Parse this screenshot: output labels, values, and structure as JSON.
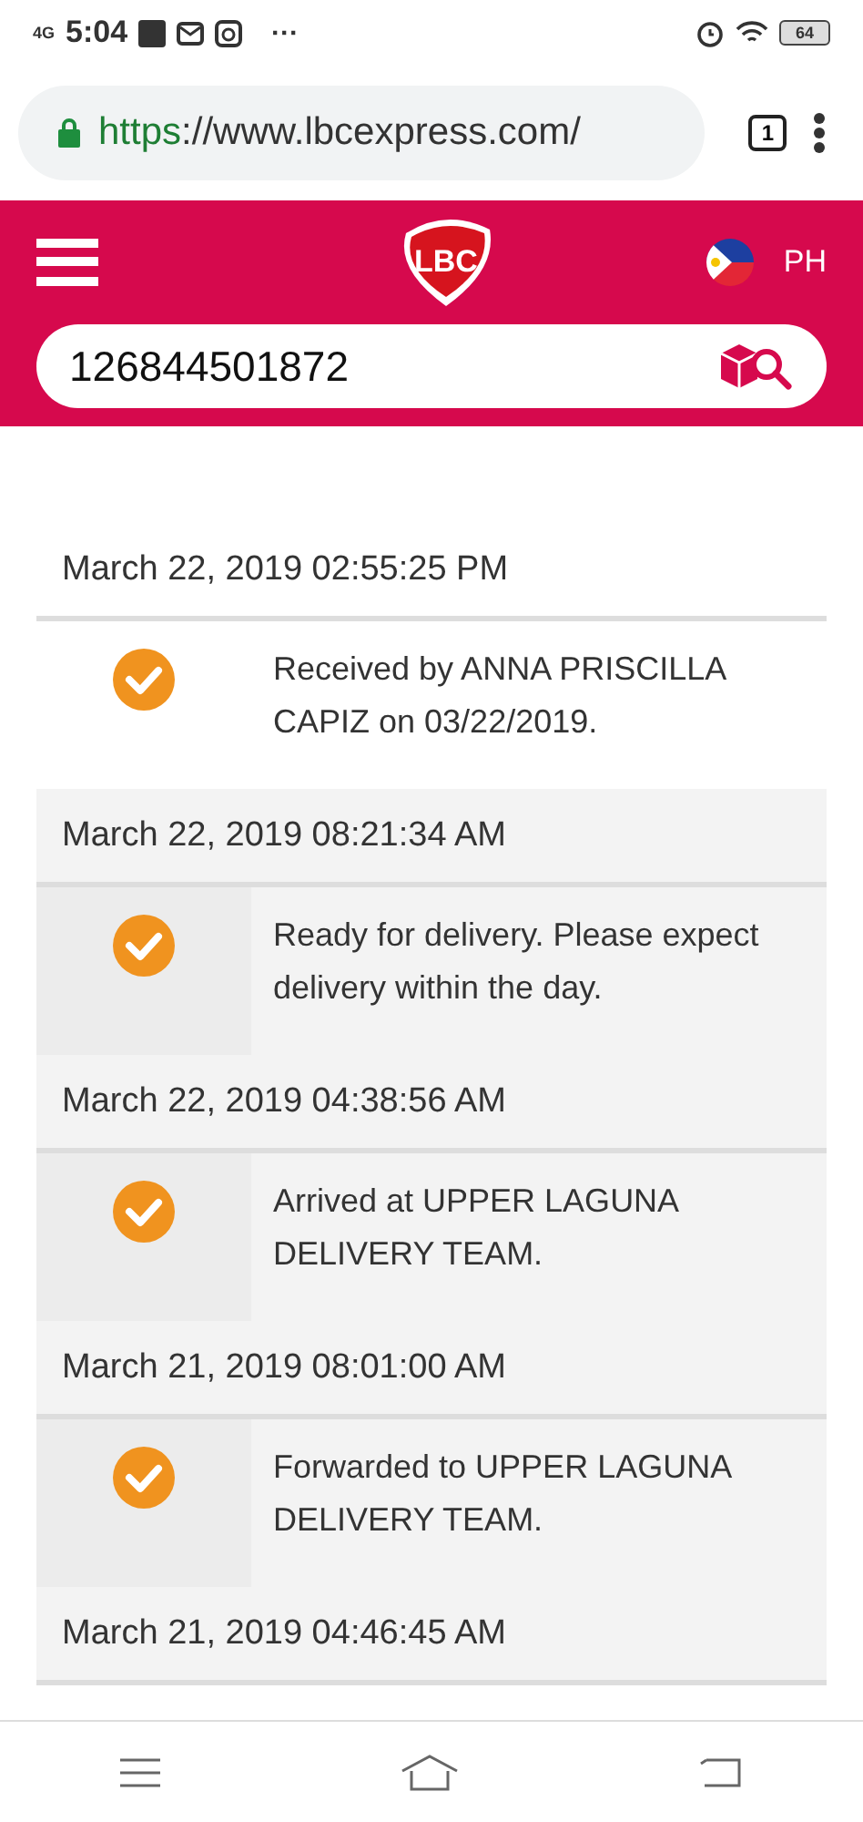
{
  "status_bar": {
    "network": "4G",
    "time": "5:04",
    "more": "···",
    "battery": "64"
  },
  "browser": {
    "url_scheme": "https",
    "url_rest": "://www.lbcexpress.com/",
    "tab_count": "1"
  },
  "header": {
    "logo_text": "LBC",
    "country": "PH"
  },
  "search": {
    "value": "126844501872"
  },
  "entries": [
    {
      "date": "March 22, 2019 02:55:25 PM",
      "status": "Received by ANNA PRISCILLA CAPIZ on 03/22/2019.",
      "shaded": false
    },
    {
      "date": "March 22, 2019 08:21:34 AM",
      "status": "Ready for delivery. Please expect delivery within the day.",
      "shaded": true
    },
    {
      "date": "March 22, 2019 04:38:56 AM",
      "status": "Arrived at UPPER LAGUNA DELIVERY TEAM.",
      "shaded": true
    },
    {
      "date": "March 21, 2019 08:01:00 AM",
      "status": "Forwarded to UPPER LAGUNA DELIVERY TEAM.",
      "shaded": true
    },
    {
      "date": "March 21, 2019 04:46:45 AM",
      "shaded": true
    }
  ]
}
